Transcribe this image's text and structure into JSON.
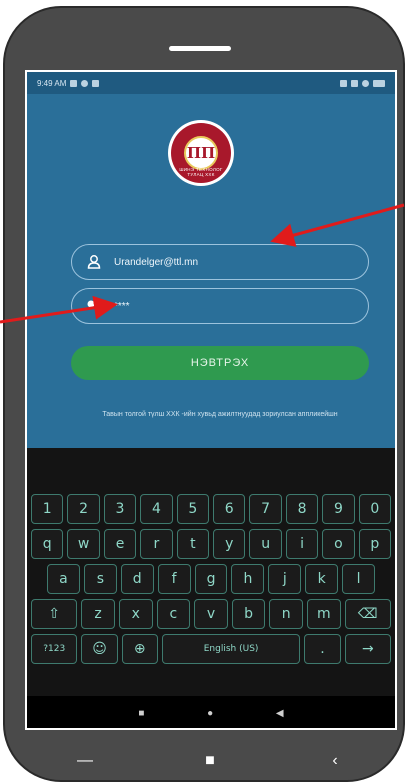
{
  "status_bar": {
    "time": "9:49 AM"
  },
  "app": {
    "logo_glyph": "ΠΠ",
    "logo_text": "ШИНЭ ТЕХНОЛОГ ТУЛАЦ ХХК",
    "email_value": "Urandelger@ttl.mn",
    "password_value": "****",
    "login_label": "НЭВТРЭХ",
    "caption": "Тавын толгой түлш ХХК -ийн хувьд ажилтнуудад зориулсан аппликейшн"
  },
  "keyboard": {
    "row1": [
      "1",
      "2",
      "3",
      "4",
      "5",
      "6",
      "7",
      "8",
      "9",
      "0"
    ],
    "row2": [
      "q",
      "w",
      "e",
      "r",
      "t",
      "y",
      "u",
      "i",
      "o",
      "p"
    ],
    "row3": [
      "a",
      "s",
      "d",
      "f",
      "g",
      "h",
      "j",
      "k",
      "l"
    ],
    "row4": [
      "⇧",
      "z",
      "x",
      "c",
      "v",
      "b",
      "n",
      "m",
      "⌫"
    ],
    "row5": [
      "?123",
      "☺",
      "⊕",
      "English (US)",
      ".",
      "→"
    ]
  },
  "system_nav": {
    "recent": "■",
    "home": "●",
    "back": "◀"
  },
  "phone_nav": {
    "menu": "—",
    "home": "■",
    "back": "‹"
  },
  "colors": {
    "app_bg": "#2a6f99",
    "login_button": "#2f9a4f",
    "arrow": "#e01b1b",
    "keyboard_bg": "#141414"
  }
}
